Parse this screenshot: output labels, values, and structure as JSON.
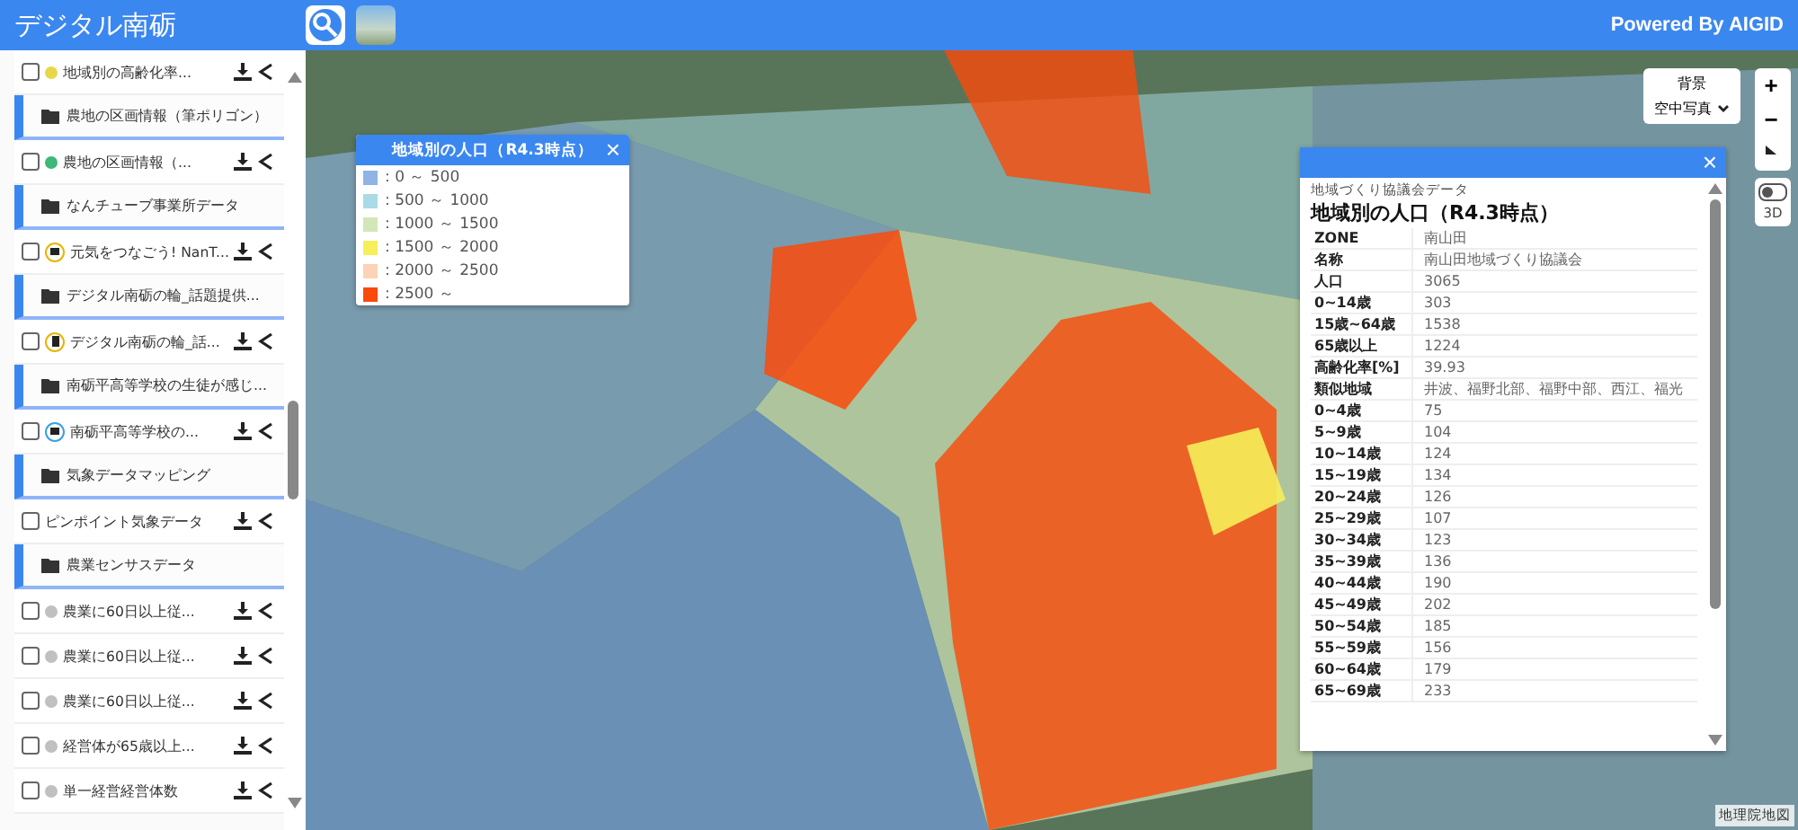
{
  "header": {
    "title": "デジタル南砺",
    "powered_by": "Powered By AIGID"
  },
  "sidebar": {
    "items": [
      {
        "kind": "layer",
        "label": "地域別の高齢化率...",
        "checked": false,
        "marker": {
          "kind": "dot",
          "color": "#e6d84a"
        }
      },
      {
        "kind": "group",
        "label": "農地の区画情報（筆ポリゴン）"
      },
      {
        "kind": "layer",
        "label": "農地の区画情報（...",
        "checked": false,
        "marker": {
          "kind": "dot",
          "color": "#3cb878"
        }
      },
      {
        "kind": "group",
        "label": "なんチューブ事業所データ"
      },
      {
        "kind": "layer",
        "label": "元気をつなごう! NanT...",
        "checked": false,
        "marker": {
          "kind": "camera",
          "color": "#e8b400"
        }
      },
      {
        "kind": "group",
        "label": "デジタル南砺の輪_話題提供..."
      },
      {
        "kind": "layer",
        "label": "デジタル南砺の輪_話...",
        "checked": false,
        "marker": {
          "kind": "building",
          "color": "#e8b400"
        }
      },
      {
        "kind": "group",
        "label": "南砺平高等学校の生徒が感じ..."
      },
      {
        "kind": "layer",
        "label": "南砺平高等学校の...",
        "checked": false,
        "marker": {
          "kind": "camera",
          "color": "#3aa0e0"
        }
      },
      {
        "kind": "group",
        "label": "気象データマッピング"
      },
      {
        "kind": "layer",
        "label": "ピンポイント気象データ",
        "checked": false
      },
      {
        "kind": "group",
        "label": "農業センサスデータ"
      },
      {
        "kind": "layer",
        "label": "農業に60日以上従...",
        "checked": false,
        "marker": {
          "kind": "dot",
          "color": "#c0c0c0"
        }
      },
      {
        "kind": "layer",
        "label": "農業に60日以上従...",
        "checked": false,
        "marker": {
          "kind": "dot",
          "color": "#c0c0c0"
        }
      },
      {
        "kind": "layer",
        "label": "農業に60日以上従...",
        "checked": false,
        "marker": {
          "kind": "dot",
          "color": "#c0c0c0"
        }
      },
      {
        "kind": "layer",
        "label": "経営体が65歳以上...",
        "checked": false,
        "marker": {
          "kind": "dot",
          "color": "#c0c0c0"
        }
      },
      {
        "kind": "layer",
        "label": "単一経営経営体数",
        "checked": false,
        "marker": {
          "kind": "dot",
          "color": "#c0c0c0"
        }
      }
    ]
  },
  "legend": {
    "title": "地域別の人口（R4.3時点）",
    "close": "×",
    "entries": [
      {
        "label": ": 0 ～ 500",
        "color": "#8fb4e6"
      },
      {
        "label": ": 500 ～ 1000",
        "color": "#a9dbe6"
      },
      {
        "label": ": 1000 ～ 1500",
        "color": "#d3e6b8"
      },
      {
        "label": ": 1500 ～ 2000",
        "color": "#f5ef5a"
      },
      {
        "label": ": 2000 ～ 2500",
        "color": "#fcd3b6"
      },
      {
        "label": ": 2500 ～",
        "color": "#fa4a0a"
      }
    ]
  },
  "basemap": {
    "label": "背景",
    "value": "空中写真"
  },
  "map_controls": {
    "zoom_in": "+",
    "zoom_out": "−",
    "toggle_3d": {
      "label": "3D",
      "on": false
    }
  },
  "info_panel": {
    "close": "×",
    "source": "地域づくり協議会データ",
    "title": "地域別の人口（R4.3時点）",
    "rows": [
      {
        "key": "ZONE",
        "value": "南山田"
      },
      {
        "key": "名称",
        "value": "南山田地域づくり協議会"
      },
      {
        "key": "人口",
        "value": "3065"
      },
      {
        "key": "0~14歳",
        "value": "303"
      },
      {
        "key": "15歳~64歳",
        "value": "1538"
      },
      {
        "key": "65歳以上",
        "value": "1224"
      },
      {
        "key": "高齢化率[%]",
        "value": "39.93"
      },
      {
        "key": "類似地域",
        "value": "井波、福野北部、福野中部、西江、福光"
      },
      {
        "key": "0~4歳",
        "value": "75"
      },
      {
        "key": "5~9歳",
        "value": "104"
      },
      {
        "key": "10~14歳",
        "value": "124"
      },
      {
        "key": "15~19歳",
        "value": "134"
      },
      {
        "key": "20~24歳",
        "value": "126"
      },
      {
        "key": "25~29歳",
        "value": "107"
      },
      {
        "key": "30~34歳",
        "value": "123"
      },
      {
        "key": "35~39歳",
        "value": "136"
      },
      {
        "key": "40~44歳",
        "value": "190"
      },
      {
        "key": "45~49歳",
        "value": "202"
      },
      {
        "key": "50~54歳",
        "value": "185"
      },
      {
        "key": "55~59歳",
        "value": "156"
      },
      {
        "key": "60~64歳",
        "value": "179"
      },
      {
        "key": "65~69歳",
        "value": "233"
      }
    ]
  },
  "attribution": "地理院地図"
}
